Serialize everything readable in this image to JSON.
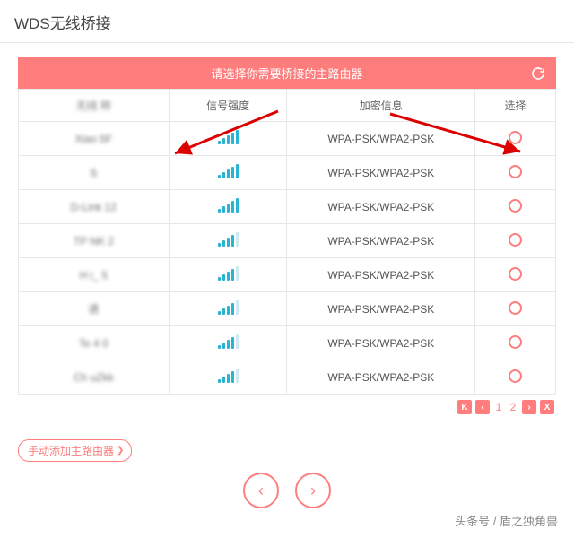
{
  "page_title": "WDS无线桥接",
  "banner_text": "请选择你需要桥接的主路由器",
  "columns": {
    "name": "无线   称",
    "signal": "信号强度",
    "encryption": "加密信息",
    "select": "选择"
  },
  "rows": [
    {
      "name": "Xiao       5F",
      "enc": "WPA-PSK/WPA2-PSK",
      "bars": 5
    },
    {
      "name": "S     ",
      "enc": "WPA-PSK/WPA2-PSK",
      "bars": 5
    },
    {
      "name": "D-Link      12",
      "enc": "WPA-PSK/WPA2-PSK",
      "bars": 5
    },
    {
      "name": "TP  NK      2",
      "enc": "WPA-PSK/WPA2-PSK",
      "bars": 4
    },
    {
      "name": "H   i_    5",
      "enc": "WPA-PSK/WPA2-PSK",
      "bars": 4
    },
    {
      "name": "    诱",
      "enc": "WPA-PSK/WPA2-PSK",
      "bars": 4
    },
    {
      "name": "Te     4    0",
      "enc": "WPA-PSK/WPA2-PSK",
      "bars": 4
    },
    {
      "name": "Ch       uZkk",
      "enc": "WPA-PSK/WPA2-PSK",
      "bars": 4
    }
  ],
  "pager": {
    "page1": "1",
    "page2": "2"
  },
  "manual_add_label": "手动添加主路由器",
  "footer_text": "头条号 / 盾之独角兽"
}
